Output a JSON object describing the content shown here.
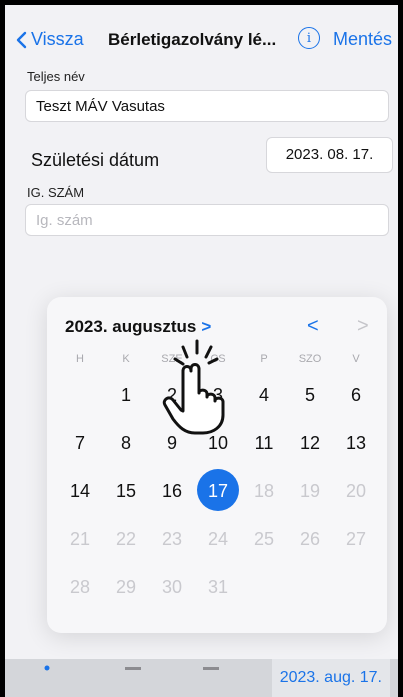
{
  "nav": {
    "back_label": "Vissza",
    "title": "Bérletigazolvány lé...",
    "info_symbol": "i",
    "save_label": "Mentés"
  },
  "form": {
    "full_name_label": "Teljes név",
    "full_name_value": "Teszt MÁV Vasutas",
    "dob_label": "Születési dátum",
    "dob_value": "2023. 08. 17.",
    "id_label": "IG. SZÁM",
    "id_placeholder": "Ig. szám"
  },
  "calendar": {
    "month_title": "2023. augusztus",
    "month_chevron": ">",
    "prev_symbol": "<",
    "next_symbol": ">",
    "weekdays": [
      "H",
      "K",
      "SZE",
      "CS",
      "P",
      "SZO",
      "V"
    ],
    "rows": [
      [
        "",
        "1",
        "2",
        "3",
        "4",
        "5",
        "6"
      ],
      [
        "7",
        "8",
        "9",
        "10",
        "11",
        "12",
        "13"
      ],
      [
        "14",
        "15",
        "16",
        "17",
        "18",
        "19",
        "20"
      ],
      [
        "21",
        "22",
        "23",
        "24",
        "25",
        "26",
        "27"
      ],
      [
        "28",
        "29",
        "30",
        "31",
        "",
        "",
        ""
      ]
    ],
    "selected_day": "17",
    "accent": "#1a73e8"
  },
  "footer": {
    "date_label": "2023. aug. 17."
  }
}
